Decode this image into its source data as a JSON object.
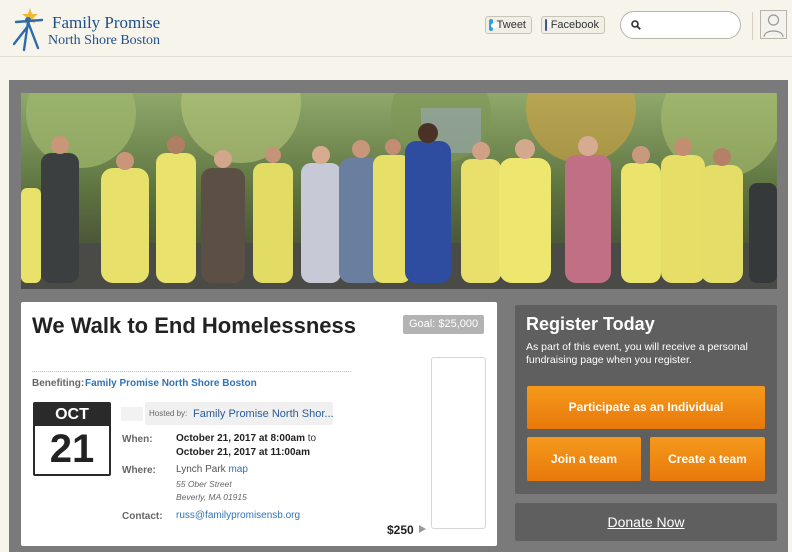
{
  "header": {
    "logo": {
      "line1": "Family Promise",
      "line2": "North Shore Boston"
    },
    "tweet_label": "Tweet",
    "facebook_label": "Facebook",
    "search": {
      "placeholder": "",
      "value": ""
    }
  },
  "event": {
    "title": "We Walk to End Homelessness",
    "goal": "Goal: $25,000",
    "benefiting_label": "Benefiting:",
    "benefiting_org": "Family Promise North Shore Boston",
    "calendar": {
      "month": "OCT",
      "day": "21"
    },
    "hosted_by_label": "Hosted by:",
    "host_name": "Family Promise North Shor...",
    "when_label": "When:",
    "when_line1_bold": "October 21, 2017 at 8:00am",
    "when_line1_tail": " to",
    "when_line2_bold": "October 21, 2017 at 11:00am",
    "where_label": "Where:",
    "venue": "Lynch Park",
    "map_link": "map",
    "address_line1": "55 Ober Street",
    "address_line2": "Beverly, MA 01915",
    "contact_label": "Contact:",
    "contact_email": "russ@familypromisensb.org",
    "level_amount": "$250"
  },
  "register": {
    "title": "Register Today",
    "text": "As part of this event, you will receive a personal fundraising page when you register.",
    "individual_button": "Participate as an Individual",
    "join_team_button": "Join a team",
    "create_team_button": "Create a team",
    "donate_button": "Donate Now"
  },
  "colors": {
    "accent_orange": "#f08a14",
    "link_blue": "#2f74b5",
    "panel_gray": "#5f5f5f",
    "frame_gray": "#7a7a7a",
    "header_bg": "#f7f4ec"
  },
  "icons": [
    "family-promise-logo-icon",
    "twitter-icon",
    "facebook-icon",
    "search-icon",
    "user-avatar-icon",
    "play-arrow-icon"
  ]
}
